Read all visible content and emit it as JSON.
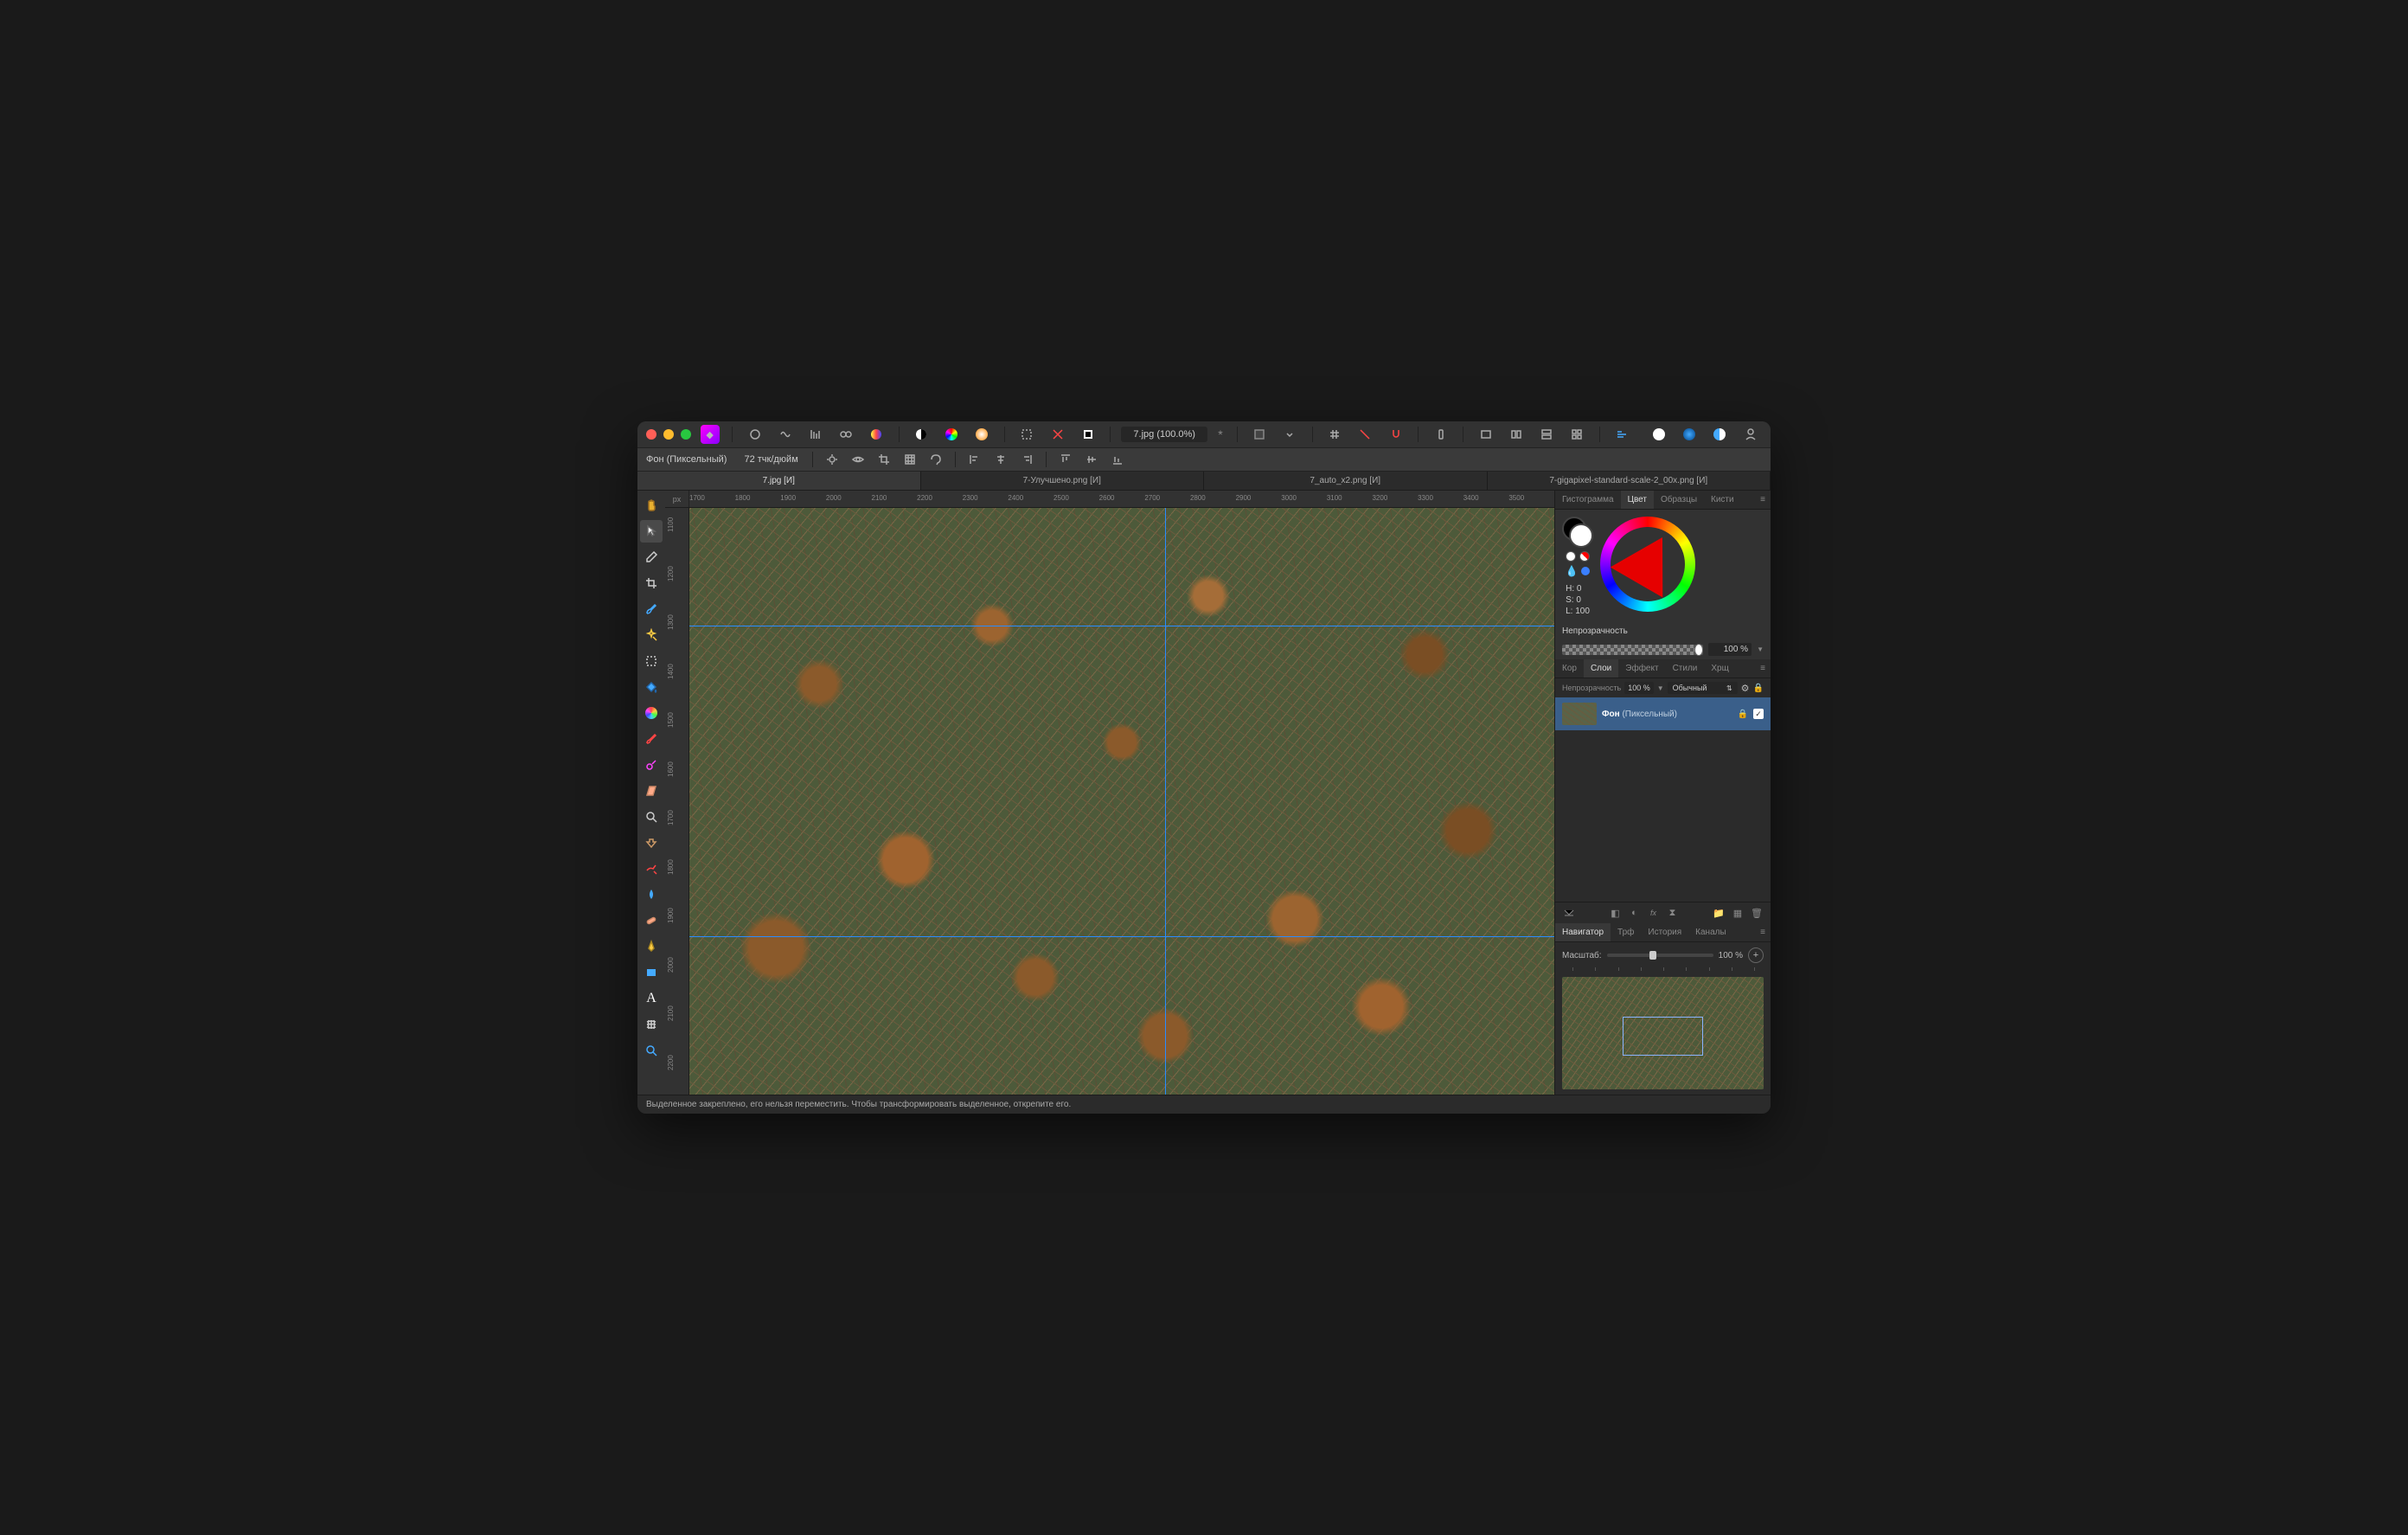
{
  "titlebar": {
    "doc_name": "7.jpg (100.0%)",
    "modified_indicator": "*"
  },
  "contextbar": {
    "layer_label": "Фон (Пиксельный)",
    "dpi": "72 тчк/дюйм"
  },
  "doc_tabs": [
    {
      "label": "7.jpg [И]",
      "active": true
    },
    {
      "label": "7-Улучшено.png [И]",
      "active": false
    },
    {
      "label": "7_auto_x2.png [И]",
      "active": false
    },
    {
      "label": "7-gigapixel-standard-scale-2_00x.png [И]",
      "active": false
    }
  ],
  "ruler_unit": "px",
  "ruler_h_ticks": [
    "1700",
    "1800",
    "1900",
    "2000",
    "2100",
    "2200",
    "2300",
    "2400",
    "2500",
    "2600",
    "2700",
    "2800",
    "2900",
    "3000",
    "3100",
    "3200",
    "3300",
    "3400",
    "3500"
  ],
  "ruler_v_ticks": [
    "1100",
    "1200",
    "1300",
    "1400",
    "1500",
    "1600",
    "1700",
    "1800",
    "1900",
    "2000",
    "2100",
    "2200"
  ],
  "right_top_tabs": [
    {
      "label": "Гистограмма",
      "active": false
    },
    {
      "label": "Цвет",
      "active": true
    },
    {
      "label": "Образцы",
      "active": false
    },
    {
      "label": "Кисти",
      "active": false
    }
  ],
  "color": {
    "h": "H: 0",
    "s": "S: 0",
    "l": "L: 100",
    "opacity_label": "Непрозрачность",
    "opacity_value": "100 %"
  },
  "mid_tabs": [
    {
      "label": "Кор",
      "active": false
    },
    {
      "label": "Слои",
      "active": true
    },
    {
      "label": "Эффект",
      "active": false
    },
    {
      "label": "Стили",
      "active": false
    },
    {
      "label": "Хрщ",
      "active": false
    }
  ],
  "layers": {
    "opacity_label": "Непрозрачность",
    "opacity_value": "100 %",
    "blend_mode": "Обычный",
    "items": [
      {
        "name": "Фон",
        "type": "(Пиксельный)",
        "visible": true,
        "locked": true
      }
    ]
  },
  "bottom_tabs": [
    {
      "label": "Навигатор",
      "active": true
    },
    {
      "label": "Трф",
      "active": false
    },
    {
      "label": "История",
      "active": false
    },
    {
      "label": "Каналы",
      "active": false
    }
  ],
  "navigator": {
    "zoom_label": "Масштаб:",
    "zoom_value": "100 %"
  },
  "statusbar": {
    "message": "Выделенное закреплено, его нельзя переместить. Чтобы трансформировать выделенное, открепите его."
  }
}
